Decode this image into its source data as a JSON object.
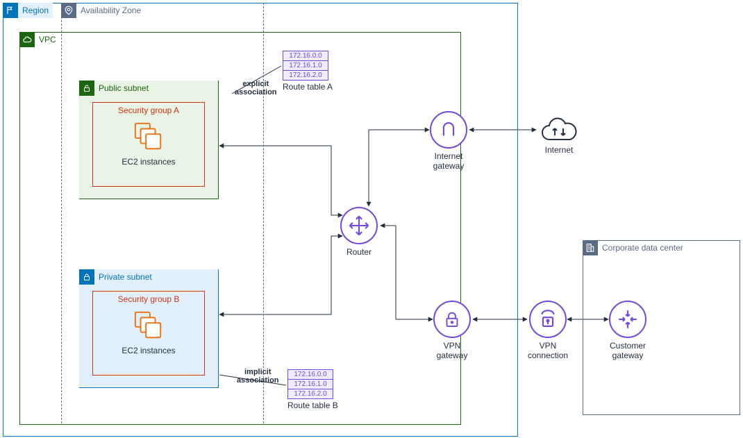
{
  "region": {
    "label": "Region"
  },
  "availability_zone": {
    "label": "Availability Zone"
  },
  "vpc": {
    "label": "VPC"
  },
  "subnets": {
    "public": {
      "label": "Public subnet"
    },
    "private": {
      "label": "Private subnet"
    }
  },
  "security_groups": {
    "a": {
      "title": "Security group A",
      "instances_label": "EC2 instances"
    },
    "b": {
      "title": "Security group B",
      "instances_label": "EC2 instances"
    }
  },
  "route_tables": {
    "a": {
      "label": "Route table A",
      "routes": [
        "172.16.0.0",
        "172.16.1.0",
        "172.16.2.0"
      ]
    },
    "b": {
      "label": "Route table B",
      "routes": [
        "172.16.0.0",
        "172.16.1.0",
        "172.16.2.0"
      ]
    }
  },
  "associations": {
    "explicit": "explicit\nassociation",
    "implicit": "implicit\nassociation"
  },
  "nodes": {
    "router": {
      "label": "Router"
    },
    "igw": {
      "label": "Internet\ngateway"
    },
    "internet": {
      "label": "Internet"
    },
    "vpngw": {
      "label": "VPN\ngateway"
    },
    "vpncon": {
      "label": "VPN\nconnection"
    },
    "cgw": {
      "label": "Customer\ngateway"
    }
  },
  "corporate": {
    "label": "Corporate data center"
  }
}
